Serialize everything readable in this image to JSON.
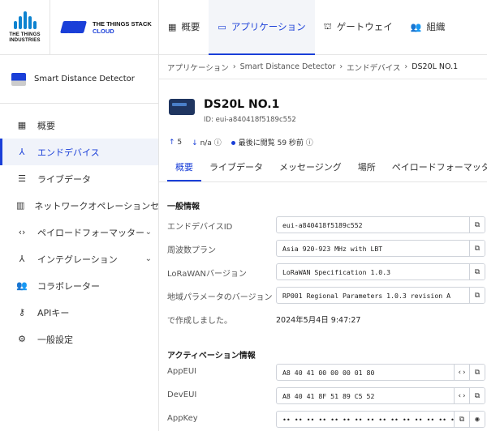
{
  "brand": {
    "ttn_line1": "THE THINGS",
    "ttn_line2": "INDUSTRIES",
    "stack_line1": "THE THINGS STACK",
    "stack_line2": "CLOUD"
  },
  "nav": {
    "items": [
      {
        "label": "概要",
        "icon": "grid-icon"
      },
      {
        "label": "アプリケーション",
        "icon": "app-window-icon"
      },
      {
        "label": "ゲートウェイ",
        "icon": "router-icon"
      },
      {
        "label": "組織",
        "icon": "group-icon"
      }
    ]
  },
  "sidebar": {
    "app_name": "Smart Distance Detector",
    "items": [
      {
        "label": "概要",
        "icon": "grid-icon"
      },
      {
        "label": "エンドデバイス",
        "icon": "device-hub-icon"
      },
      {
        "label": "ライブデータ",
        "icon": "list-icon"
      },
      {
        "label": "ネットワークオペレーションセンター",
        "icon": "bar-chart-icon"
      },
      {
        "label": "ペイロードフォーマッター",
        "icon": "code-icon"
      },
      {
        "label": "インテグレーション",
        "icon": "merge-icon"
      },
      {
        "label": "コラボレーター",
        "icon": "people-icon"
      },
      {
        "label": "APIキー",
        "icon": "key-icon"
      },
      {
        "label": "一般設定",
        "icon": "gear-icon"
      }
    ]
  },
  "breadcrumb": [
    "アプリケーション",
    "Smart Distance Detector",
    "エンドデバイス",
    "DS20L NO.1"
  ],
  "device": {
    "name": "DS20L NO.1",
    "id_label": "ID: eui-a840418f5189c552",
    "uplink": "5",
    "downlink": "n/a",
    "last_seen": "最後に閲覧 59 秒前"
  },
  "tabs": [
    "概要",
    "ライブデータ",
    "メッセージング",
    "場所",
    "ペイロードフォーマッター"
  ],
  "general": {
    "title": "一般情報",
    "rows": [
      {
        "label": "エンドデバイスID",
        "value": "eui-a840418f5189c552"
      },
      {
        "label": "周波数プラン",
        "value": "Asia 920-923 MHz with LBT"
      },
      {
        "label": "LoRaWANバージョン",
        "value": "LoRaWAN Specification 1.0.3"
      },
      {
        "label": "地域パラメータのバージョン",
        "value": "RP001 Regional Parameters 1.0.3 revision A"
      },
      {
        "label": "で作成しました。",
        "value": "2024年5月4日 9:47:27"
      }
    ]
  },
  "activation": {
    "title": "アクティベーション情報",
    "rows": [
      {
        "label": "AppEUI",
        "value": "A8 40 41 00 00 00 01 80"
      },
      {
        "label": "DevEUI",
        "value": "A8 40 41 8F 51 89 C5 52"
      },
      {
        "label": "AppKey",
        "value": "•• •• •• •• •• •• •• •• •• •• •• •• •• •• •• ••"
      }
    ]
  }
}
